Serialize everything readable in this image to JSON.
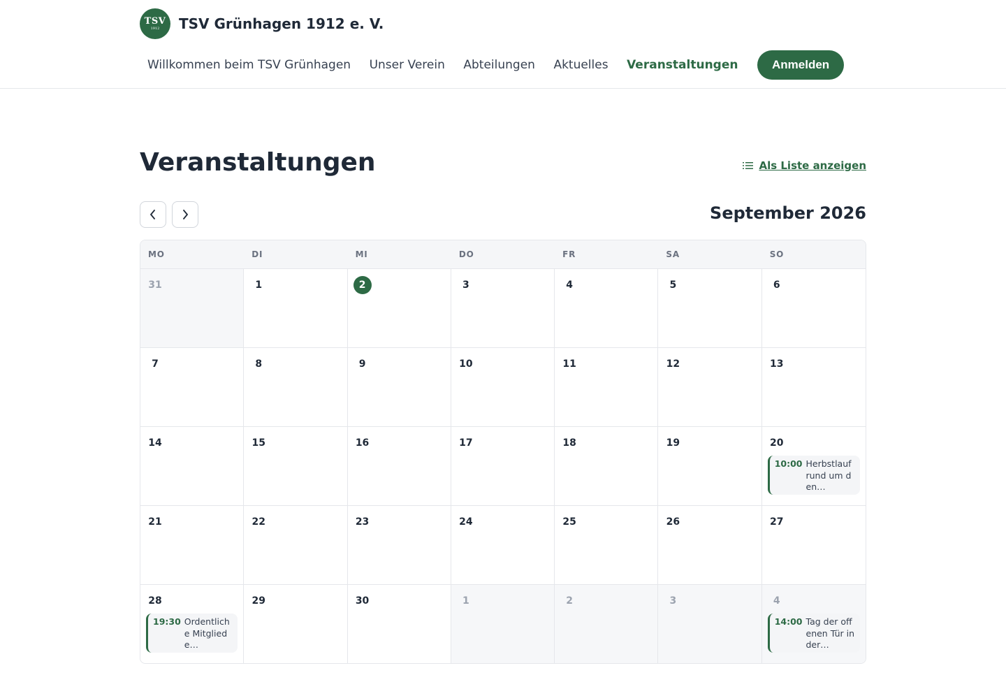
{
  "brand": {
    "logo_line1": "TSV",
    "logo_line2": "1912",
    "name": "TSV Grünhagen 1912 e. V."
  },
  "nav": {
    "items": [
      {
        "label": "Willkommen beim TSV Grünhagen",
        "active": false
      },
      {
        "label": "Unser Verein",
        "active": false
      },
      {
        "label": "Abteilungen",
        "active": false
      },
      {
        "label": "Aktuelles",
        "active": false
      },
      {
        "label": "Veranstaltungen",
        "active": true
      }
    ],
    "login_label": "Anmelden"
  },
  "page": {
    "title": "Veranstaltungen",
    "list_link": "Als Liste anzeigen"
  },
  "calendar": {
    "month_title": "September 2026",
    "weekdays": [
      "MO",
      "DI",
      "MI",
      "DO",
      "FR",
      "SA",
      "SO"
    ],
    "weeks": [
      [
        {
          "day": "31",
          "outside": true
        },
        {
          "day": "1"
        },
        {
          "day": "2",
          "today": true
        },
        {
          "day": "3"
        },
        {
          "day": "4"
        },
        {
          "day": "5"
        },
        {
          "day": "6"
        }
      ],
      [
        {
          "day": "7"
        },
        {
          "day": "8"
        },
        {
          "day": "9"
        },
        {
          "day": "10"
        },
        {
          "day": "11"
        },
        {
          "day": "12"
        },
        {
          "day": "13"
        }
      ],
      [
        {
          "day": "14"
        },
        {
          "day": "15"
        },
        {
          "day": "16"
        },
        {
          "day": "17"
        },
        {
          "day": "18"
        },
        {
          "day": "19"
        },
        {
          "day": "20",
          "events": [
            {
              "time": "10:00",
              "title": "Herbstlauf rund um den…"
            }
          ]
        }
      ],
      [
        {
          "day": "21"
        },
        {
          "day": "22"
        },
        {
          "day": "23"
        },
        {
          "day": "24"
        },
        {
          "day": "25"
        },
        {
          "day": "26"
        },
        {
          "day": "27"
        }
      ],
      [
        {
          "day": "28",
          "events": [
            {
              "time": "19:30",
              "title": "Ordentliche Mitgliede…"
            }
          ]
        },
        {
          "day": "29"
        },
        {
          "day": "30"
        },
        {
          "day": "1",
          "outside": true
        },
        {
          "day": "2",
          "outside": true
        },
        {
          "day": "3",
          "outside": true
        },
        {
          "day": "4",
          "outside": true,
          "events": [
            {
              "time": "14:00",
              "title": "Tag der offenen Tür in der…"
            }
          ]
        }
      ]
    ]
  },
  "colors": {
    "accent": "#2d6a45",
    "text": "#1f2937",
    "border": "#e5e7eb",
    "outside_bg": "#f6f7f9"
  },
  "icons": {
    "list": "list-icon",
    "prev": "chevron-left-icon",
    "next": "chevron-right-icon"
  }
}
